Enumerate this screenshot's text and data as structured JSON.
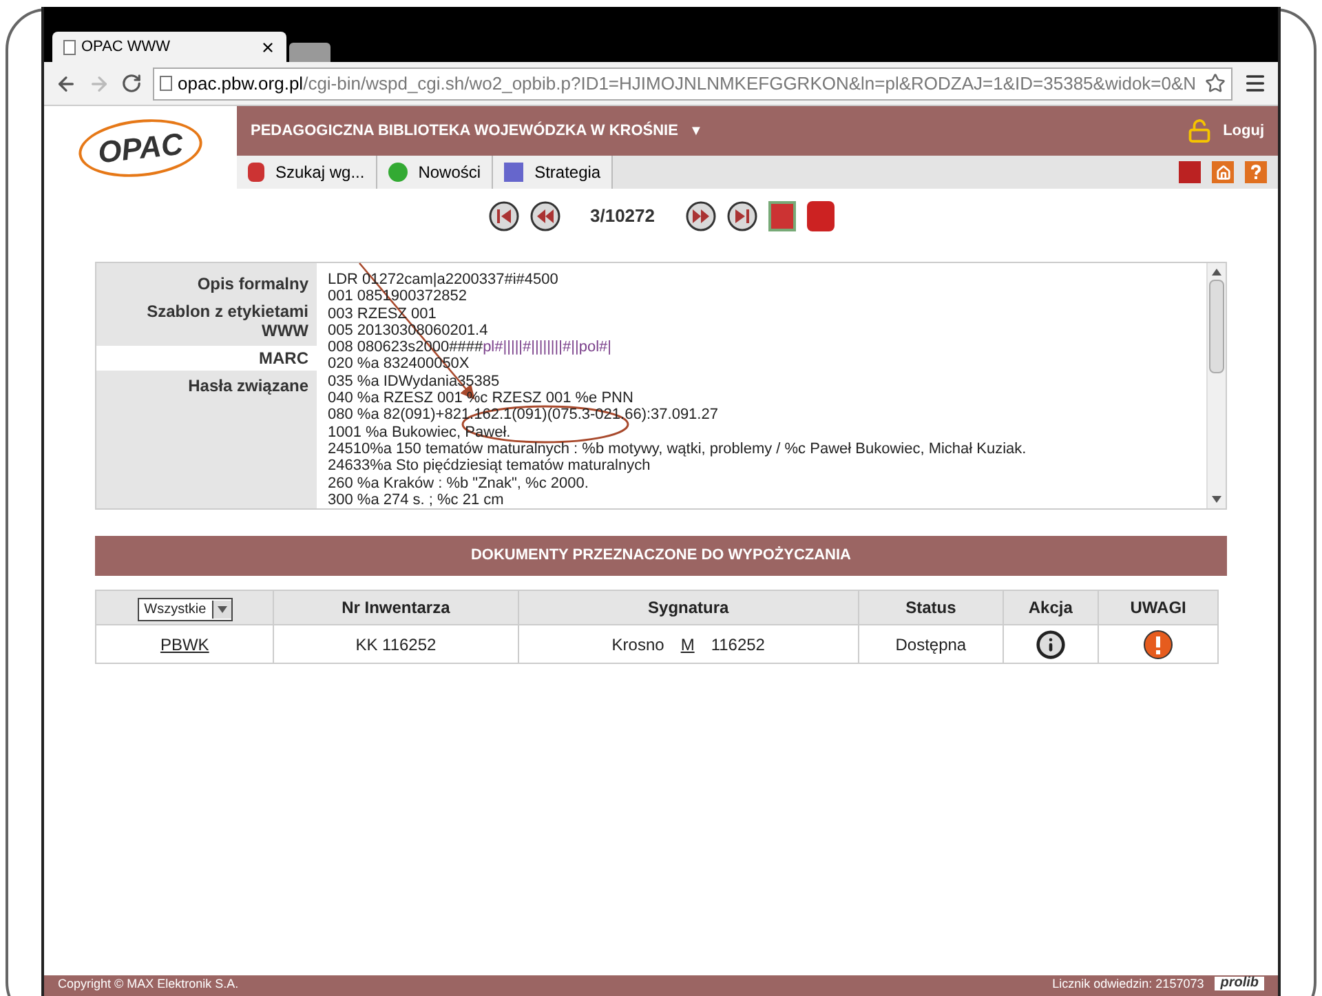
{
  "browser": {
    "tabs": [
      {
        "title": "OPAC WWW",
        "selected": true
      },
      {
        "selected": false
      }
    ],
    "url_host": "opac.pbw.org.pl",
    "url_path": "/cgi-bin/wspd_cgi.sh/wo2_opbib.p?ID1=HJIMOJNLNMKEFGGRKON&ln=pl&RODZAJ=1&ID=35385&widok=0&N"
  },
  "header": {
    "logo": "OPAC",
    "library": "PEDAGOGICZNA BIBLIOTEKA WOJEWÓDZKA W KROŚNIE",
    "caret": "▼",
    "login": "Loguj"
  },
  "toolbar": [
    "Szukaj wg...",
    "Nowości",
    "Strategia"
  ],
  "pager": {
    "position": "3/10272"
  },
  "record_tabs": [
    {
      "label": "Opis formalny",
      "selected": false
    },
    {
      "label": "Szablon z etykietami WWW",
      "selected": false
    },
    {
      "label": "MARC",
      "selected": true
    },
    {
      "label": "Hasła związane",
      "selected": false
    }
  ],
  "marc_lines": [
    {
      "text": "LDR 01272cam|a2200337#i#4500"
    },
    {
      "text": "001 0851900372852"
    },
    {
      "text": "003 RZESZ 001"
    },
    {
      "text": "005 20130308060201.4"
    },
    {
      "text": "008 080623s2000####",
      "marked": "pl#|||||#||||||||#||pol#|"
    },
    {
      "text": "020 %a 832400050X"
    },
    {
      "text": "035 %a IDWydania35385"
    },
    {
      "text": "040 %a RZESZ 001 %c RZESZ 001 %e PNN"
    },
    {
      "text": "080 %a 82(091)+821.162.1(091)(075.3-021.66):37.091.27"
    },
    {
      "text": "1001 %a Bukowiec, Paweł."
    },
    {
      "text": "24510%a 150 tematów maturalnych : %b motywy, wątki, problemy / %c Paweł Bukowiec, Michał Kuziak."
    },
    {
      "text": "24633%a Sto pięćdziesiąt tematów maturalnych"
    },
    {
      "text": "260 %a Kraków : %b \"Znak\", %c 2000."
    },
    {
      "text": "300 %a 274 s. ; %c 21 cm"
    }
  ],
  "holdings": {
    "title": "DOKUMENTY PRZEZNACZONE DO WYPOŻYCZANIA",
    "filter": "Wszystkie",
    "columns": [
      "Nr Inwentarza",
      "Sygnatura",
      "Status",
      "Akcja",
      "UWAGI"
    ],
    "rows": [
      {
        "library": "PBWK",
        "inventory": "KK 116252",
        "signature_place": "Krosno",
        "signature_code": "M",
        "signature_number": "116252",
        "status": "Dostępna"
      }
    ]
  },
  "footer": {
    "copyright": "Copyright © MAX Elektronik S.A.",
    "counter": "Licznik odwiedzin: 2157073",
    "brand": "prolib"
  }
}
